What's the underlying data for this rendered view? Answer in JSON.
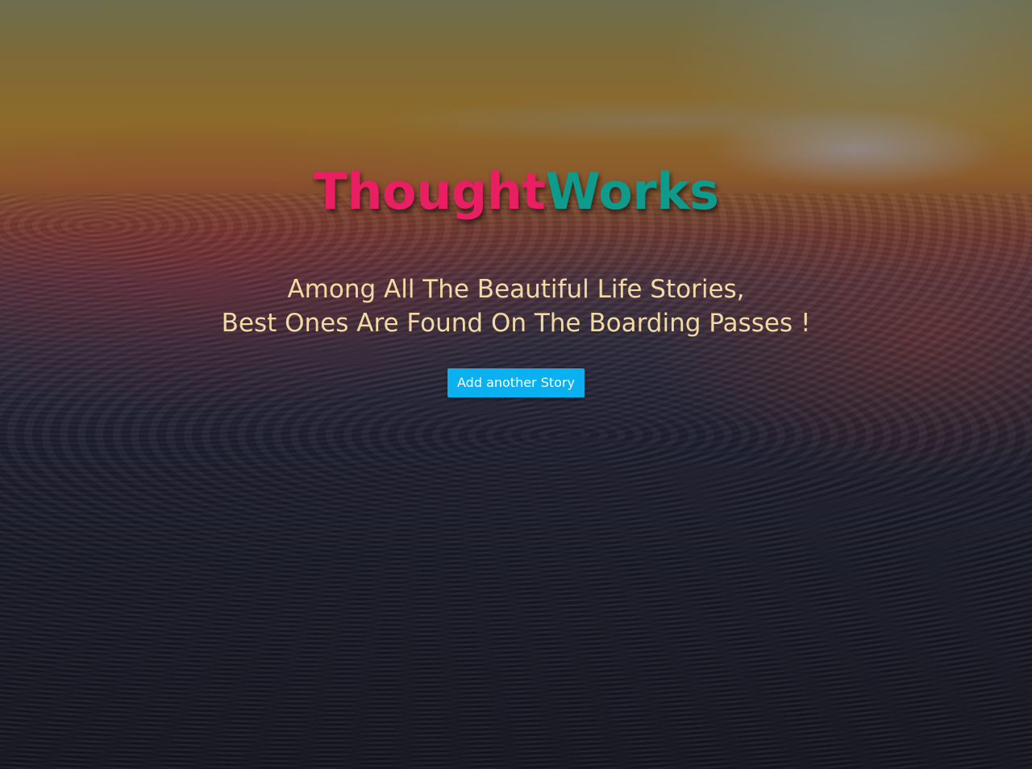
{
  "hero": {
    "brand_first": "Thought",
    "brand_second": "Works",
    "tagline_line1": "Among All The Beautiful Life Stories,",
    "tagline_line2": "Best Ones Are Found On The Boarding Passes !",
    "button_label": "Add another Story"
  },
  "colors": {
    "brand_first": "#e91e63",
    "brand_second": "#0e9b8c",
    "tagline": "#f3d9a4",
    "button_bg": "#0bb0f0",
    "button_text": "#ffffff"
  }
}
